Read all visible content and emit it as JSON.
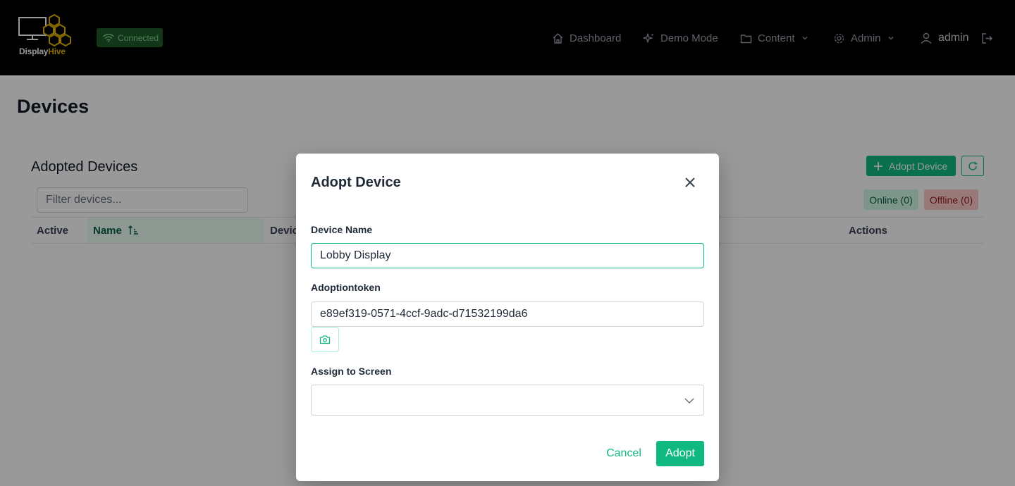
{
  "app": {
    "brand_prefix": "Display",
    "brand_suffix": "Hive",
    "connection_status": "Connected"
  },
  "nav": {
    "dashboard": "Dashboard",
    "demo_mode": "Demo Mode",
    "content": "Content",
    "admin": "Admin",
    "user": "admin"
  },
  "page": {
    "title": "Devices",
    "card_title": "Adopted Devices",
    "filter_placeholder": "Filter devices...",
    "adopt_button": "Adopt Device",
    "online_badge": "Online (0)",
    "offline_badge": "Offline (0)",
    "columns": {
      "active": "Active",
      "name": "Name",
      "device": "Devic",
      "actions": "Actions"
    }
  },
  "modal": {
    "title": "Adopt Device",
    "device_name_label": "Device Name",
    "device_name_value": "Lobby Display",
    "token_label": "Adoptiontoken",
    "token_value": "e89ef319-0571-4ccf-9adc-d71532199da6",
    "assign_label": "Assign to Screen",
    "assign_value": "",
    "cancel": "Cancel",
    "submit": "Adopt"
  },
  "colors": {
    "accent": "#10b981",
    "header_bg": "#000000",
    "brand_gold": "#e6b800",
    "online_bg": "#d1fae5",
    "offline_bg": "#fecaca"
  }
}
